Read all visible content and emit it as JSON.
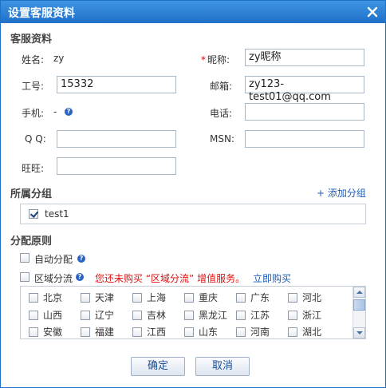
{
  "dialog": {
    "title": "设置客服资料",
    "close_icon": "close-icon"
  },
  "profile": {
    "section_title": "客服资料",
    "name_label": "姓名:",
    "name_value": "zy",
    "nickname_required": "*",
    "nickname_label": "昵称:",
    "nickname_value": "zy昵称",
    "employee_id_label": "工号:",
    "employee_id_value": "15332",
    "email_label": "邮箱:",
    "email_value": "zy123-test01@qq.com",
    "mobile_label": "手机:",
    "mobile_value": "-",
    "phone_label": "电话:",
    "phone_value": "",
    "qq_label": "Q Q:",
    "qq_value": "",
    "msn_label": "MSN:",
    "msn_value": "",
    "wangwang_label": "旺旺:",
    "wangwang_value": ""
  },
  "group": {
    "section_title": "所属分组",
    "add_link": "+ 添加分组",
    "items": [
      {
        "name": "test1",
        "checked": true
      }
    ]
  },
  "assignment": {
    "section_title": "分配原则",
    "auto_label": "自动分配",
    "auto_checked": false,
    "region_label": "区域分流",
    "region_checked": false,
    "warning": "您还未购买 “区域分流” 增值服务。",
    "buy_link": "立即购买",
    "regions": [
      "北京",
      "天津",
      "上海",
      "重庆",
      "广东",
      "河北",
      "山西",
      "辽宁",
      "吉林",
      "黑龙江",
      "江苏",
      "浙江",
      "安徽",
      "福建",
      "江西",
      "山东",
      "河南",
      "湖北"
    ]
  },
  "buttons": {
    "confirm": "确定",
    "cancel": "取消"
  },
  "colors": {
    "titlebar": "#1f70c7",
    "link": "#1c5fb8",
    "warning": "#e01010",
    "required": "#dd0000"
  }
}
